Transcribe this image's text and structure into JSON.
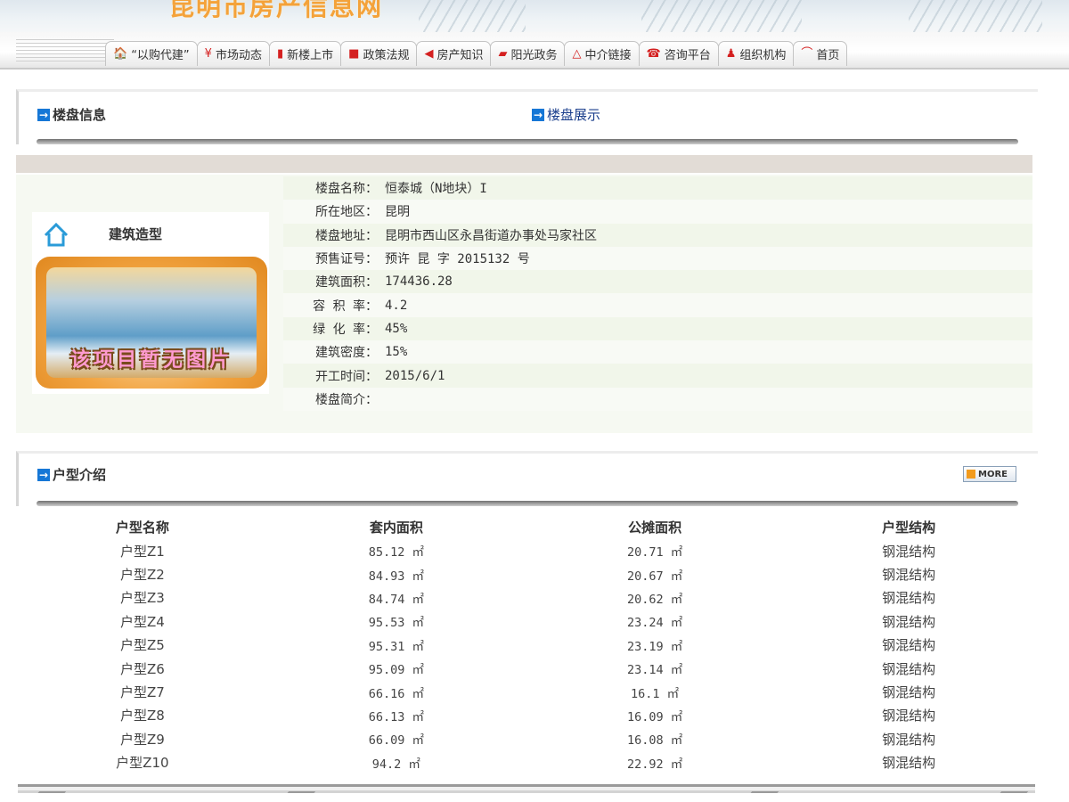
{
  "banner": {
    "title": "昆明市房产信息网"
  },
  "nav": {
    "items": [
      {
        "icon": "house-icon",
        "glyph": "🏠",
        "label": "“以购代建”"
      },
      {
        "icon": "yen-icon",
        "glyph": "¥",
        "label": "市场动态"
      },
      {
        "icon": "bar-chart-icon",
        "glyph": "▮",
        "label": "新楼上市"
      },
      {
        "icon": "book-icon",
        "glyph": "■",
        "label": "政策法规"
      },
      {
        "icon": "fish-icon",
        "glyph": "◀",
        "label": "房产知识"
      },
      {
        "icon": "sun-icon",
        "glyph": "▰",
        "label": "阳光政务"
      },
      {
        "icon": "triangle-icon",
        "glyph": "△",
        "label": "中介链接"
      },
      {
        "icon": "phone-icon",
        "glyph": "☎",
        "label": "咨询平台"
      },
      {
        "icon": "people-icon",
        "glyph": "♟",
        "label": "组织机构"
      },
      {
        "icon": "home-icon",
        "glyph": "⌒",
        "label": "首页"
      }
    ]
  },
  "sections": {
    "info_title": "楼盘信息",
    "display_link": "楼盘展示",
    "unit_title": "户型介绍",
    "more": "MORE"
  },
  "property": {
    "image_caption": "建筑造型",
    "no_image_text": "该项目暂无图片",
    "fields": [
      {
        "label": "楼盘名称：",
        "value": "恒泰城（N地块）I"
      },
      {
        "label": "所在地区：",
        "value": "昆明"
      },
      {
        "label": "楼盘地址：",
        "value": "昆明市西山区永昌街道办事处马家社区"
      },
      {
        "label": "预售证号：",
        "value": "预许 昆 字 2015132 号"
      },
      {
        "label": "建筑面积：",
        "value": "174436.28"
      },
      {
        "label": "容 积 率：",
        "value": "4.2"
      },
      {
        "label": "绿 化 率：",
        "value": "45%"
      },
      {
        "label": "建筑密度：",
        "value": "15%"
      },
      {
        "label": "开工时间：",
        "value": "2015/6/1"
      },
      {
        "label": "楼盘简介：",
        "value": ""
      }
    ]
  },
  "units": {
    "headers": [
      "户型名称",
      "套内面积",
      "公摊面积",
      "户型结构"
    ],
    "rows": [
      [
        "户型Z1",
        "85.12 ㎡",
        "20.71 ㎡",
        "钢混结构"
      ],
      [
        "户型Z2",
        "84.93 ㎡",
        "20.67 ㎡",
        "钢混结构"
      ],
      [
        "户型Z3",
        "84.74 ㎡",
        "20.62 ㎡",
        "钢混结构"
      ],
      [
        "户型Z4",
        "95.53 ㎡",
        "23.24 ㎡",
        "钢混结构"
      ],
      [
        "户型Z5",
        "95.31 ㎡",
        "23.19 ㎡",
        "钢混结构"
      ],
      [
        "户型Z6",
        "95.09 ㎡",
        "23.14 ㎡",
        "钢混结构"
      ],
      [
        "户型Z7",
        "66.16 ㎡",
        "16.1 ㎡",
        "钢混结构"
      ],
      [
        "户型Z8",
        "66.13 ㎡",
        "16.09 ㎡",
        "钢混结构"
      ],
      [
        "户型Z9",
        "66.09 ㎡",
        "16.08 ㎡",
        "钢混结构"
      ],
      [
        "户型Z10",
        "94.2 ㎡",
        "22.92 ㎡",
        "钢混结构"
      ]
    ]
  },
  "colors": {
    "title": "#f4a23a",
    "nav_icon": "#d42020",
    "arrow": "#1677d6",
    "link": "#1a3e8c"
  }
}
